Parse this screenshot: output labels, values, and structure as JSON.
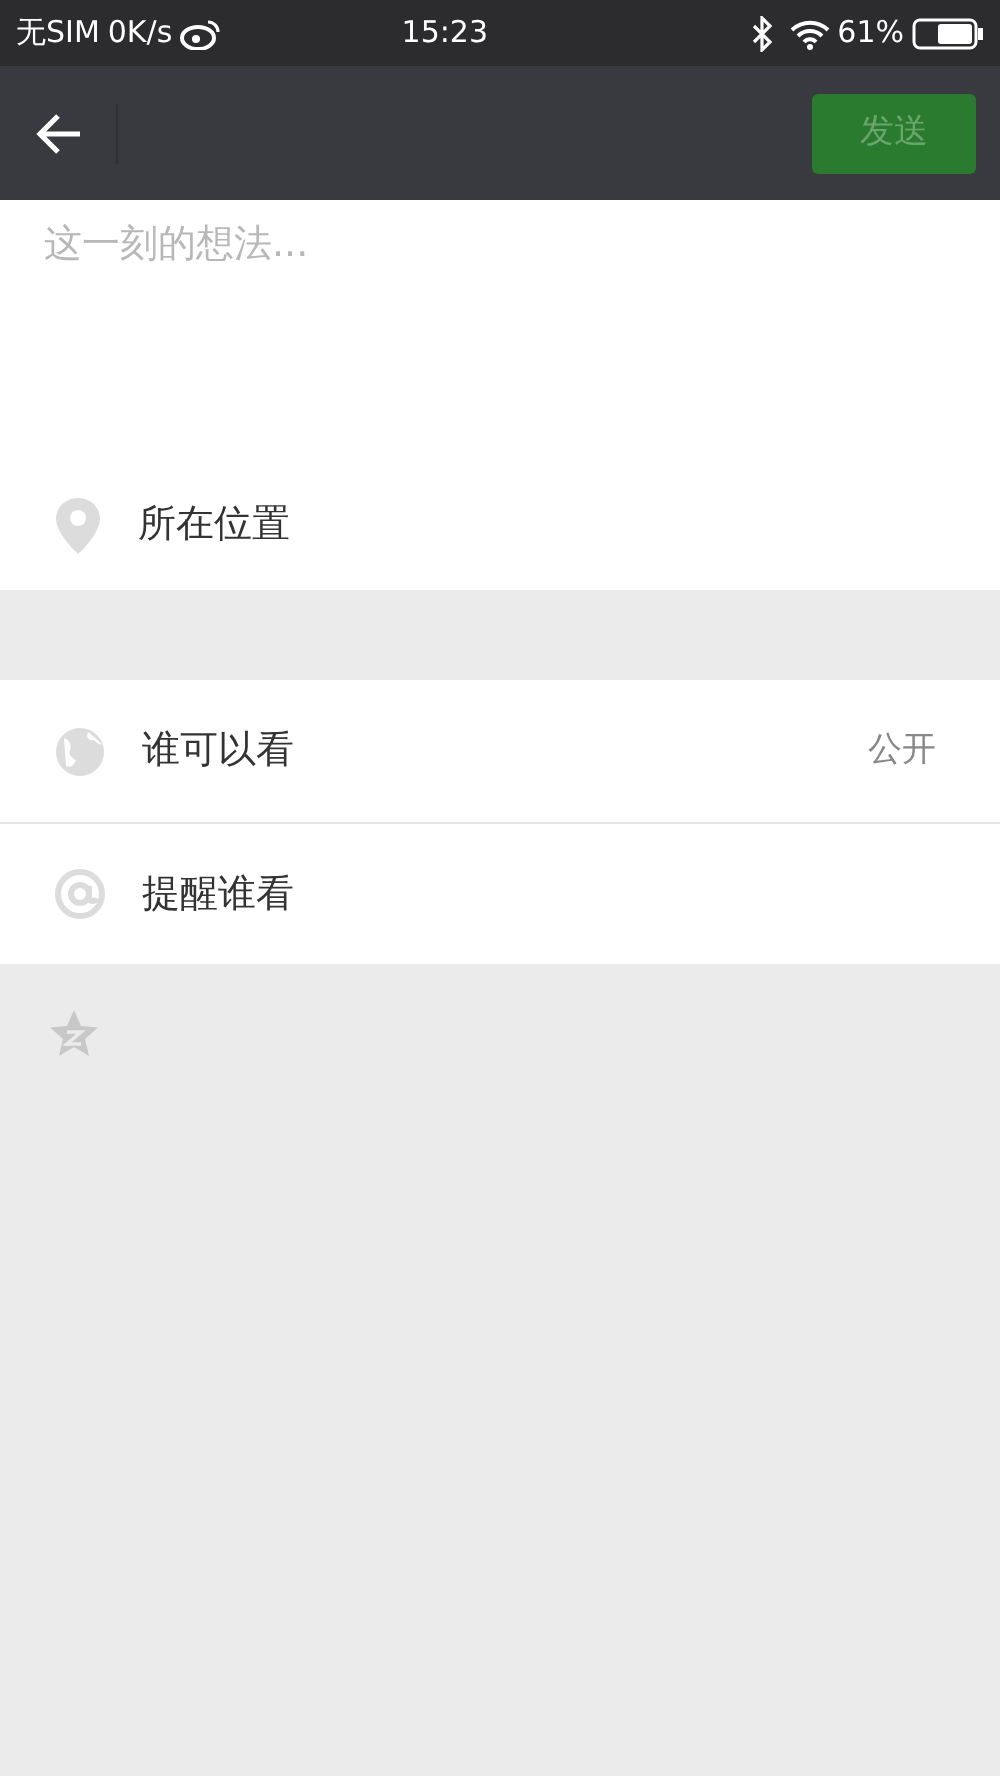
{
  "status_bar": {
    "carrier": "无SIM",
    "speed": "0K/s",
    "time": "15:23",
    "battery": "61%"
  },
  "toolbar": {
    "send_button": {
      "label": "发送",
      "disabled": true
    }
  },
  "post": {
    "placeholder": "这一刻的想法..."
  },
  "location": {
    "label": "所在位置"
  },
  "settings": [
    {
      "kind": "globe",
      "label": "谁可以看",
      "value": "公开"
    },
    {
      "kind": "at",
      "label": "提醒谁看"
    }
  ]
}
